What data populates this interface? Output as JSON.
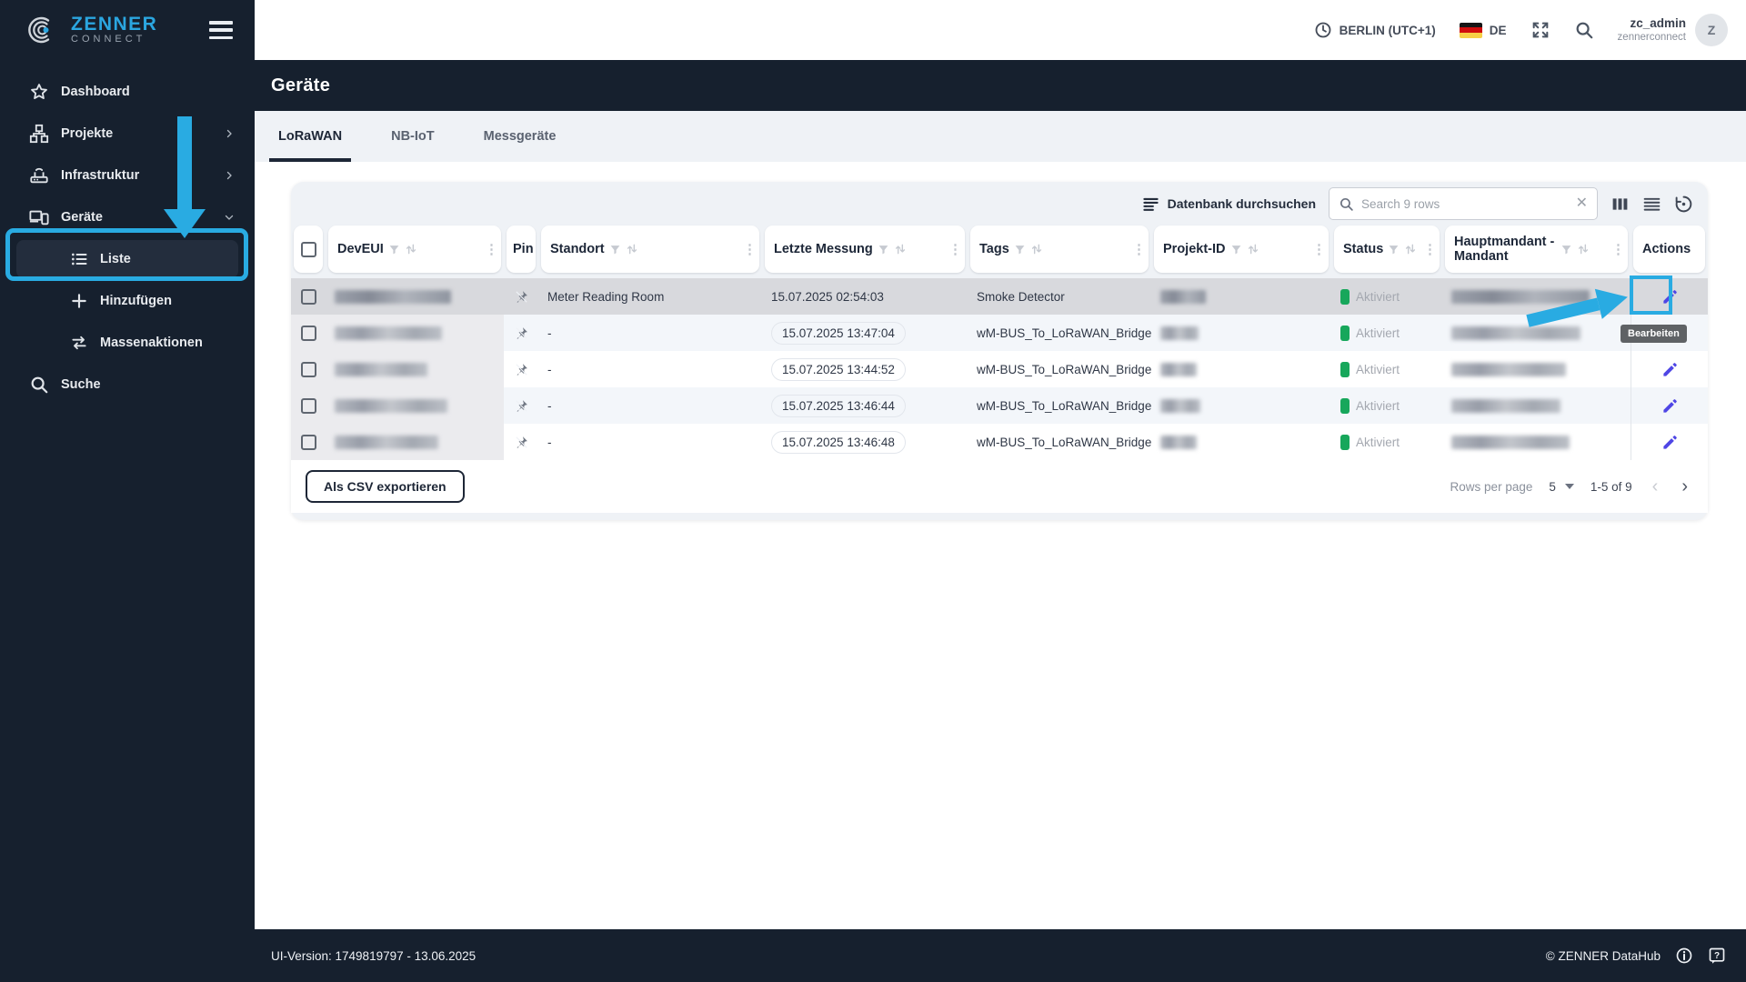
{
  "colors": {
    "accent_blue": "#29abe2",
    "brand_blue": "#2ba6e0",
    "dark_navy": "#16202e",
    "pencil_indigo": "#4f46e5",
    "status_green": "#17a75b",
    "card_bg": "#eff2f6",
    "row_hover": "#d8d9dd",
    "alt_row": "#f3f6fa"
  },
  "sidebar": {
    "logo": {
      "line1": "ZENNER",
      "line2": "CONNECT"
    },
    "items": [
      {
        "label": "Dashboard"
      },
      {
        "label": "Projekte"
      },
      {
        "label": "Infrastruktur"
      },
      {
        "label": "Geräte"
      }
    ],
    "subitems": [
      {
        "label": "Liste"
      },
      {
        "label": "Hinzufügen"
      },
      {
        "label": "Massenaktionen"
      }
    ],
    "search_label": "Suche"
  },
  "topbar": {
    "timezone": "BERLIN (UTC+1)",
    "language": "DE",
    "user_name": "zc_admin",
    "user_org": "zennerconnect",
    "avatar_letter": "Z"
  },
  "page": {
    "title": "Geräte",
    "tabs": [
      {
        "label": "LoRaWAN"
      },
      {
        "label": "NB-IoT"
      },
      {
        "label": "Messgeräte"
      }
    ]
  },
  "table": {
    "toolbar": {
      "db_label": "Datenbank durchsuchen",
      "search_placeholder": "Search 9 rows"
    },
    "columns": {
      "deveui": "DevEUI",
      "pin": "Pin",
      "standort": "Standort",
      "messung": "Letzte Messung",
      "tags": "Tags",
      "projekt": "Projekt-ID",
      "status": "Status",
      "mandant": "Hauptmandant - Mandant",
      "actions": "Actions"
    },
    "rows": [
      {
        "standort": "Meter Reading Room",
        "messung": "15.07.2025 02:54:03",
        "tags": "Smoke Detector",
        "status": "Aktiviert"
      },
      {
        "standort": "-",
        "messung": "15.07.2025 13:47:04",
        "tags": "wM-BUS_To_LoRaWAN_Bridge",
        "status": "Aktiviert"
      },
      {
        "standort": "-",
        "messung": "15.07.2025 13:44:52",
        "tags": "wM-BUS_To_LoRaWAN_Bridge",
        "status": "Aktiviert"
      },
      {
        "standort": "-",
        "messung": "15.07.2025 13:46:44",
        "tags": "wM-BUS_To_LoRaWAN_Bridge",
        "status": "Aktiviert"
      },
      {
        "standort": "-",
        "messung": "15.07.2025 13:46:48",
        "tags": "wM-BUS_To_LoRaWAN_Bridge",
        "status": "Aktiviert"
      }
    ],
    "footer": {
      "export_label": "Als CSV exportieren",
      "rows_per_page_label": "Rows per page",
      "rows_per_page_value": "5",
      "range": "1-5 of 9"
    }
  },
  "annotation": {
    "tooltip": "Bearbeiten"
  },
  "statusbar": {
    "version": "UI-Version: 1749819797 - 13.06.2025",
    "copyright": "© ZENNER DataHub"
  }
}
